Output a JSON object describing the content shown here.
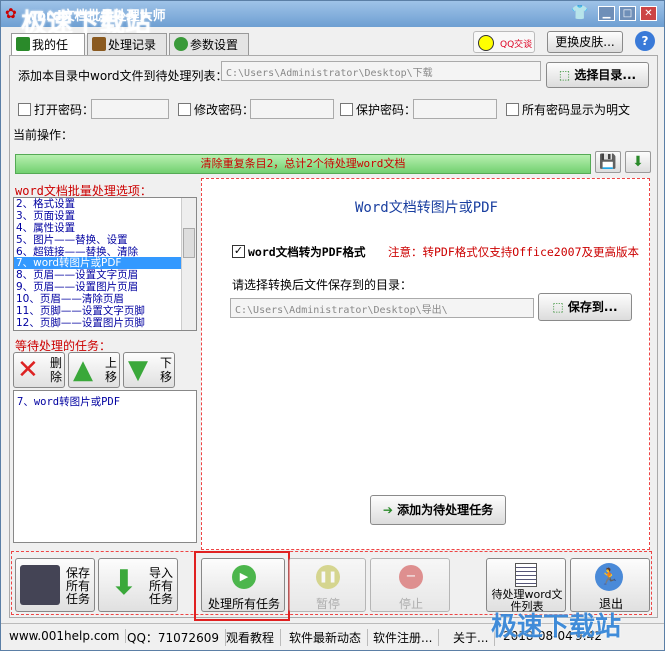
{
  "window": {
    "title": "word文档批量处理大师"
  },
  "watermark": {
    "top": "极速下载站",
    "bottom": "极速下载站"
  },
  "tabs": [
    {
      "label": "我的任务"
    },
    {
      "label": "处理记录"
    },
    {
      "label": "参数设置"
    }
  ],
  "header": {
    "qq_label": "QQ交谈",
    "skin_button": "更换皮肤..."
  },
  "dir": {
    "label": "添加本目录中word文件到待处理列表：",
    "path": "C:\\Users\\Administrator\\Desktop\\下载",
    "choose_button": "选择目录..."
  },
  "passwords": {
    "open_label": "打开密码：",
    "modify_label": "修改密码：",
    "protect_label": "保护密码：",
    "show_plain_label": "所有密码显示为明文"
  },
  "current_op_label": "当前操作：",
  "progress": {
    "text": "清除重复条目2，总计2个待处理word文档"
  },
  "options": {
    "title": "word文档批量处理选项：",
    "items": [
      "2、格式设置",
      "3、页面设置",
      "4、属性设置",
      "5、图片——替换、设置",
      "6、超链接——替换、清除",
      "7、word转图片或PDF",
      "8、页眉——设置文字页眉",
      "9、页眉——设置图片页眉",
      "10、页眉——清除页眉",
      "11、页脚——设置文字页脚",
      "12、页脚——设置图片页脚"
    ],
    "selected_index": 5
  },
  "pending": {
    "title": "等待处理的任务：",
    "delete_label": "删除",
    "up_label": "上移",
    "down_label": "下移",
    "items": [
      "7、word转图片或PDF"
    ]
  },
  "panel": {
    "title": "Word文档转图片或PDF",
    "checkbox_label": "word文档转为PDF格式",
    "note": "注意：转PDF格式仅支持Office2007及更高版本",
    "save_dir_label": "请选择转换后文件保存到的目录：",
    "save_path": "C:\\Users\\Administrator\\Desktop\\导出\\",
    "save_button": "保存到...",
    "add_task_button": "添加为待处理任务"
  },
  "bottom": {
    "save_all": "保存所有任务",
    "import_all": "导入所有任务",
    "process_all": "处理所有任务",
    "pause": "暂停",
    "stop": "停止",
    "pending_list": "待处理word文件列表",
    "exit": "退出"
  },
  "status": {
    "site": "www.001help.com",
    "qq": "QQ：71072609",
    "tutorial": "观看教程",
    "news": "软件最新动态",
    "register": "软件注册...",
    "about": "关于...",
    "date": "2018-08-04",
    "time": "9:42"
  },
  "colors": {
    "accent_red": "#cc0000",
    "title_blue": "#1a3fa0",
    "progress_green": "#72d070"
  }
}
